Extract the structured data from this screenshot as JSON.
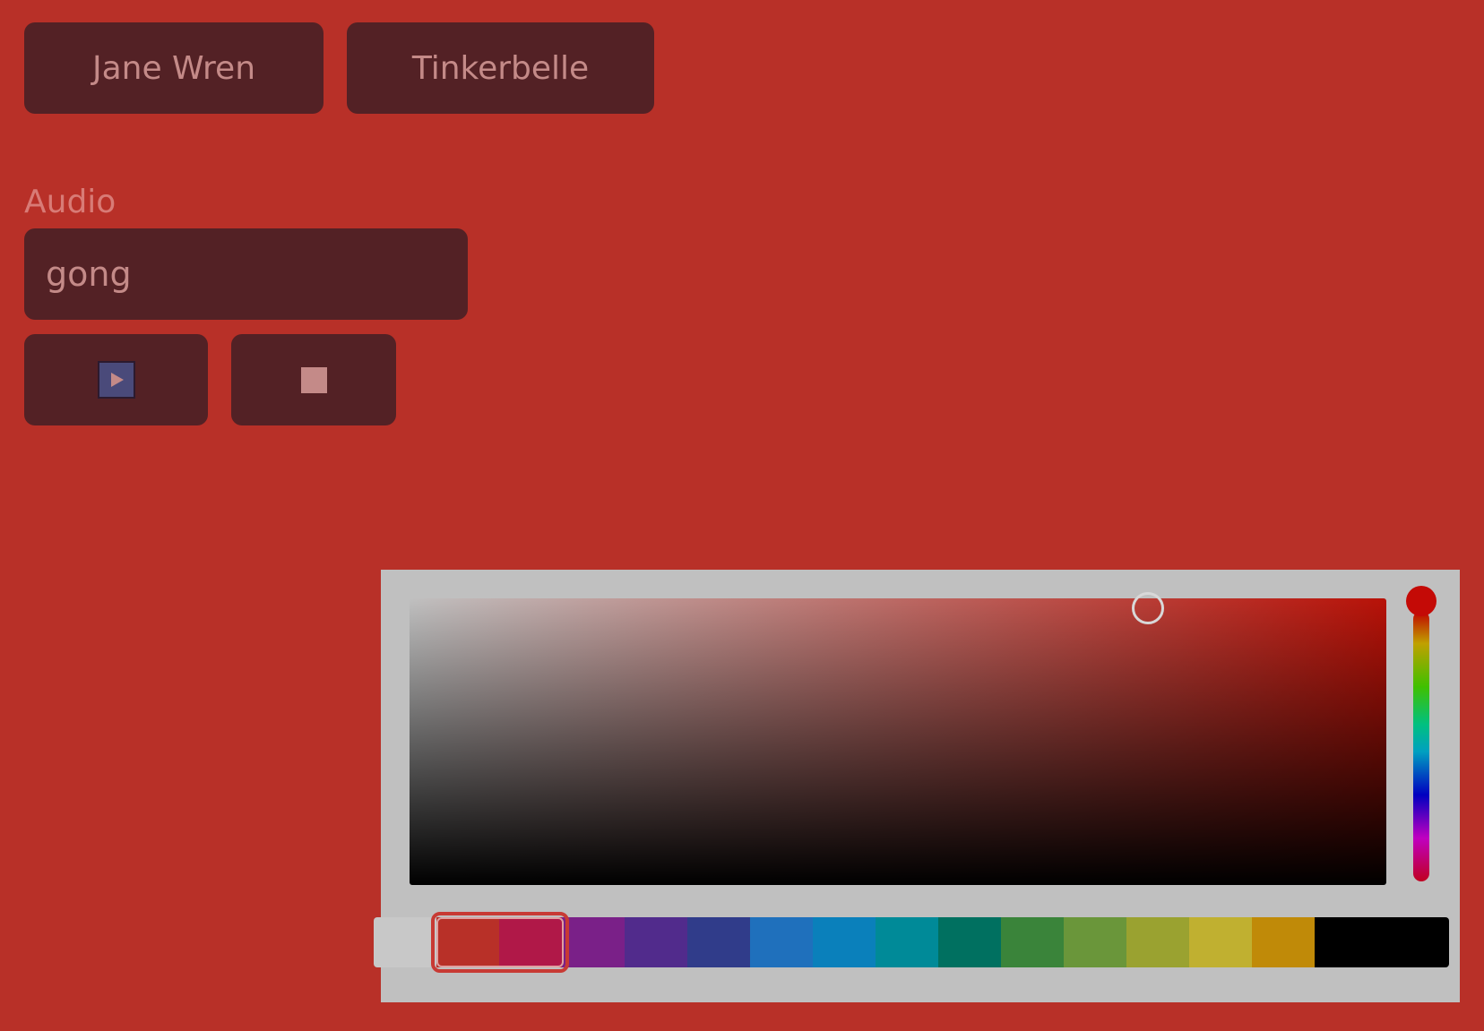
{
  "names": {
    "first": "Jane Wren",
    "second": "Tinkerbelle"
  },
  "audio": {
    "label": "Audio",
    "value": "gong"
  },
  "controls": {
    "play_icon": "play-icon",
    "stop_icon": "stop-icon"
  },
  "color_picker": {
    "hue_color": "#b81208",
    "selected_swatch_index": 1,
    "swatches": [
      "#c8c8c8",
      "#b83028",
      "#b01848",
      "#7a2088",
      "#512b8c",
      "#303c8a",
      "#1f70bc",
      "#0a80bb",
      "#008a98",
      "#007060",
      "#3a843a",
      "#6a963a",
      "#9aa230",
      "#c0b030",
      "#c08a08",
      "#000000"
    ]
  }
}
